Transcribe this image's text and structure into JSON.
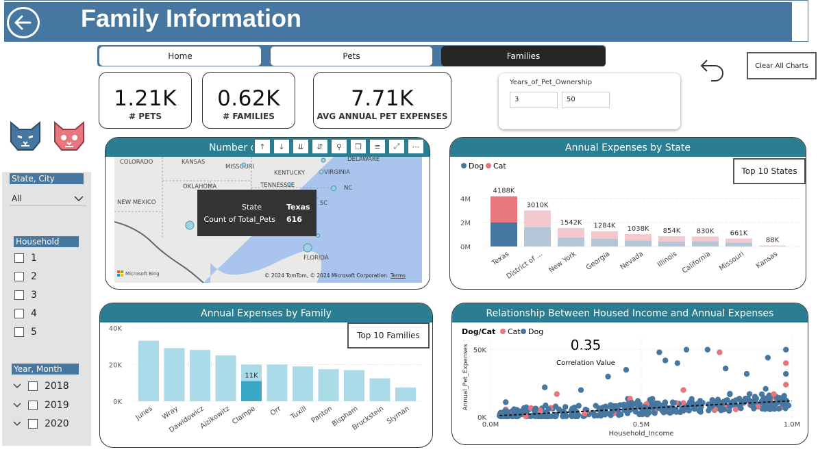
{
  "header": {
    "title": "Family Information"
  },
  "nav": {
    "home": "Home",
    "pets": "Pets",
    "families": "Families"
  },
  "kpis": [
    {
      "value": "1.21K",
      "label": "# PETS"
    },
    {
      "value": "0.62K",
      "label": "# FAMILIES"
    },
    {
      "value": "7.71K",
      "label": "AVG ANNUAL PET EXPENSES"
    }
  ],
  "years_slicer": {
    "title": "Years_of_Pet_Ownership",
    "min": "3",
    "max": "50"
  },
  "clear_all": "Clear All Charts",
  "left_slicers": {
    "state_city": {
      "title": "State, City",
      "value": "All"
    },
    "household": {
      "title": "Household",
      "options": [
        "1",
        "2",
        "3",
        "4",
        "5"
      ]
    },
    "year_month": {
      "title": "Year, Month",
      "options": [
        "2018",
        "2019",
        "2020"
      ]
    }
  },
  "map": {
    "title": "Number of Pets by State",
    "labels": [
      "COLORADO",
      "KANSAS",
      "MISSOURI",
      "DELAWARE",
      "KENTUCKY",
      "VIRGINIA",
      "OKLAHOMA",
      "TENNESSEE",
      "NC",
      "NEW MEXICO",
      "SC",
      "FLORIDA",
      "TEXAS"
    ],
    "tooltip": {
      "state_label": "State",
      "state_value": "Texas",
      "count_label": "Count of Total_Pets",
      "count_value": "616"
    },
    "attribution": "© 2024 TomTom, © 2024 Microsoft Corporation",
    "terms": "Terms",
    "brand": "Microsoft Bing"
  },
  "state_chart": {
    "title": "Annual Expenses by State",
    "button": "Top 10 States",
    "legend": [
      "Dog",
      "Cat"
    ],
    "colors": {
      "dog": "#4677a0",
      "cat": "#e8767f",
      "dog_dim": "#b4c6d8",
      "cat_dim": "#f3c9ce"
    }
  },
  "family_chart": {
    "title": "Annual Expenses by Family",
    "button": "Top 10 Families",
    "highlight_label": "11K",
    "colors": {
      "bar": "#abdae8",
      "highlight": "#3ba7c6"
    }
  },
  "scatter_chart": {
    "title": "Relationship Between Housed Income and Annual Expenses",
    "legend_title": "Dog/Cat",
    "legend": [
      "Cat",
      "Dog"
    ],
    "correlation_value": "0.35",
    "correlation_label": "Correlation Value",
    "colors": {
      "dog": "#4677a0",
      "cat": "#e8767f"
    }
  },
  "chart_data": [
    {
      "type": "bar",
      "title": "Annual Expenses by State",
      "categories": [
        "Texas",
        "District of ...",
        "New York",
        "Georgia",
        "Nevada",
        "Illinois",
        "California",
        "Missouri",
        "Kansas"
      ],
      "totals_labels": [
        "4188K",
        "3010K",
        "1542K",
        "1284K",
        "1038K",
        "854K",
        "830K",
        "661K",
        "88K"
      ],
      "series": [
        {
          "name": "Dog",
          "values": [
            2000000,
            1600000,
            750000,
            650000,
            500000,
            420000,
            430000,
            330000,
            40000
          ]
        },
        {
          "name": "Cat",
          "values": [
            2188000,
            1410000,
            792000,
            634000,
            538000,
            434000,
            400000,
            331000,
            48000
          ]
        }
      ],
      "ylim": [
        0,
        5000000
      ],
      "yticks": [
        "0M",
        "2M",
        "4M"
      ]
    },
    {
      "type": "bar",
      "title": "Annual Expenses by Family",
      "categories": [
        "Junes",
        "Wray",
        "Dawidowicz",
        "Aizikowitz",
        "Clampe",
        "Orr",
        "Tuxill",
        "Panton",
        "Bispham",
        "Bruckstein",
        "Slyman"
      ],
      "values": [
        33000,
        29000,
        28000,
        25000,
        20000,
        20000,
        19000,
        17500,
        17000,
        12500,
        7500
      ],
      "highlight_values": [
        0,
        0,
        0,
        0,
        11000,
        0,
        0,
        0,
        0,
        0,
        0
      ],
      "ylim": [
        0,
        40000
      ],
      "yticks": [
        "0K",
        "20K",
        "40K"
      ]
    },
    {
      "type": "scatter",
      "title": "Relationship Between Housed Income and Annual Expenses",
      "xlabel": "Household_Income",
      "ylabel": "Annual_Pet_Expenses",
      "xlim": [
        0,
        1000000
      ],
      "ylim": [
        0,
        60000
      ],
      "xticks": [
        "0.0M",
        "0.5M",
        "1.0M"
      ],
      "yticks": [
        "0K",
        "50K"
      ],
      "trend": [
        [
          0,
          1000
        ],
        [
          1000000,
          12000
        ]
      ],
      "outliers": [
        {
          "x": 450000,
          "y": 35000,
          "s": "Dog"
        },
        {
          "x": 560000,
          "y": 48000,
          "s": "Dog"
        },
        {
          "x": 620000,
          "y": 40000,
          "s": "Dog"
        },
        {
          "x": 580000,
          "y": 42000,
          "s": "Dog"
        },
        {
          "x": 650000,
          "y": 50000,
          "s": "Dog"
        },
        {
          "x": 720000,
          "y": 50000,
          "s": "Dog"
        },
        {
          "x": 980000,
          "y": 50000,
          "s": "Dog"
        },
        {
          "x": 920000,
          "y": 44000,
          "s": "Dog"
        },
        {
          "x": 780000,
          "y": 36000,
          "s": "Dog"
        },
        {
          "x": 300000,
          "y": 20000,
          "s": "Dog"
        },
        {
          "x": 180000,
          "y": 22000,
          "s": "Dog"
        },
        {
          "x": 390000,
          "y": 30000,
          "s": "Dog"
        },
        {
          "x": 980000,
          "y": 24000,
          "s": "Cat"
        },
        {
          "x": 760000,
          "y": 48000,
          "s": "Cat"
        },
        {
          "x": 980000,
          "y": 40000,
          "s": "Cat"
        },
        {
          "x": 220000,
          "y": 17000,
          "s": "Cat"
        },
        {
          "x": 640000,
          "y": 20000,
          "s": "Cat"
        },
        {
          "x": 940000,
          "y": 17000,
          "s": "Cat"
        },
        {
          "x": 850000,
          "y": 32000,
          "s": "Dog"
        },
        {
          "x": 980000,
          "y": 32000,
          "s": "Dog"
        }
      ]
    }
  ]
}
